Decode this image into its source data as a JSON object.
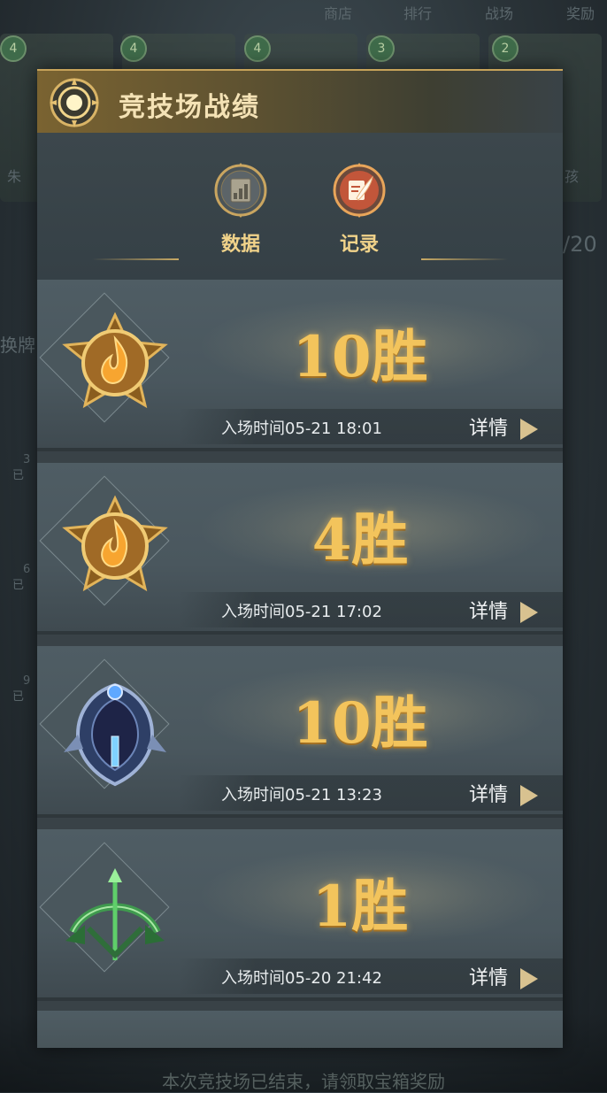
{
  "background": {
    "top_tabs": [
      "商店",
      "排行",
      "战场",
      "奖励"
    ],
    "card_badges": [
      "4",
      "4",
      "4",
      "3",
      "2"
    ],
    "side_text": [
      "朱",
      "孩",
      "/20",
      "换牌",
      "3",
      "已",
      "6",
      "已",
      "9",
      "已"
    ],
    "footer": "本次竞技场已结束，请领取宝箱奖励"
  },
  "panel": {
    "title": "竞技场战绩",
    "tabs": [
      {
        "label": "数据",
        "icon": "chart-icon",
        "selected": false
      },
      {
        "label": "记录",
        "icon": "quill-icon",
        "selected": true
      }
    ],
    "records": [
      {
        "wins": "10胜",
        "time": "入场时间05-21 18:01",
        "detail": "详情",
        "rank": "gold-flame-emblem"
      },
      {
        "wins": "4胜",
        "time": "入场时间05-21 17:02",
        "detail": "详情",
        "rank": "gold-flame-emblem"
      },
      {
        "wins": "10胜",
        "time": "入场时间05-21 13:23",
        "detail": "详情",
        "rank": "blue-helm-emblem"
      },
      {
        "wins": "1胜",
        "time": "入场时间05-20 21:42",
        "detail": "详情",
        "rank": "green-bow-emblem"
      }
    ]
  },
  "colors": {
    "accent_gold": "#f3c45c",
    "title_gold": "#f4e2b5",
    "panel_bg": "#394247"
  }
}
